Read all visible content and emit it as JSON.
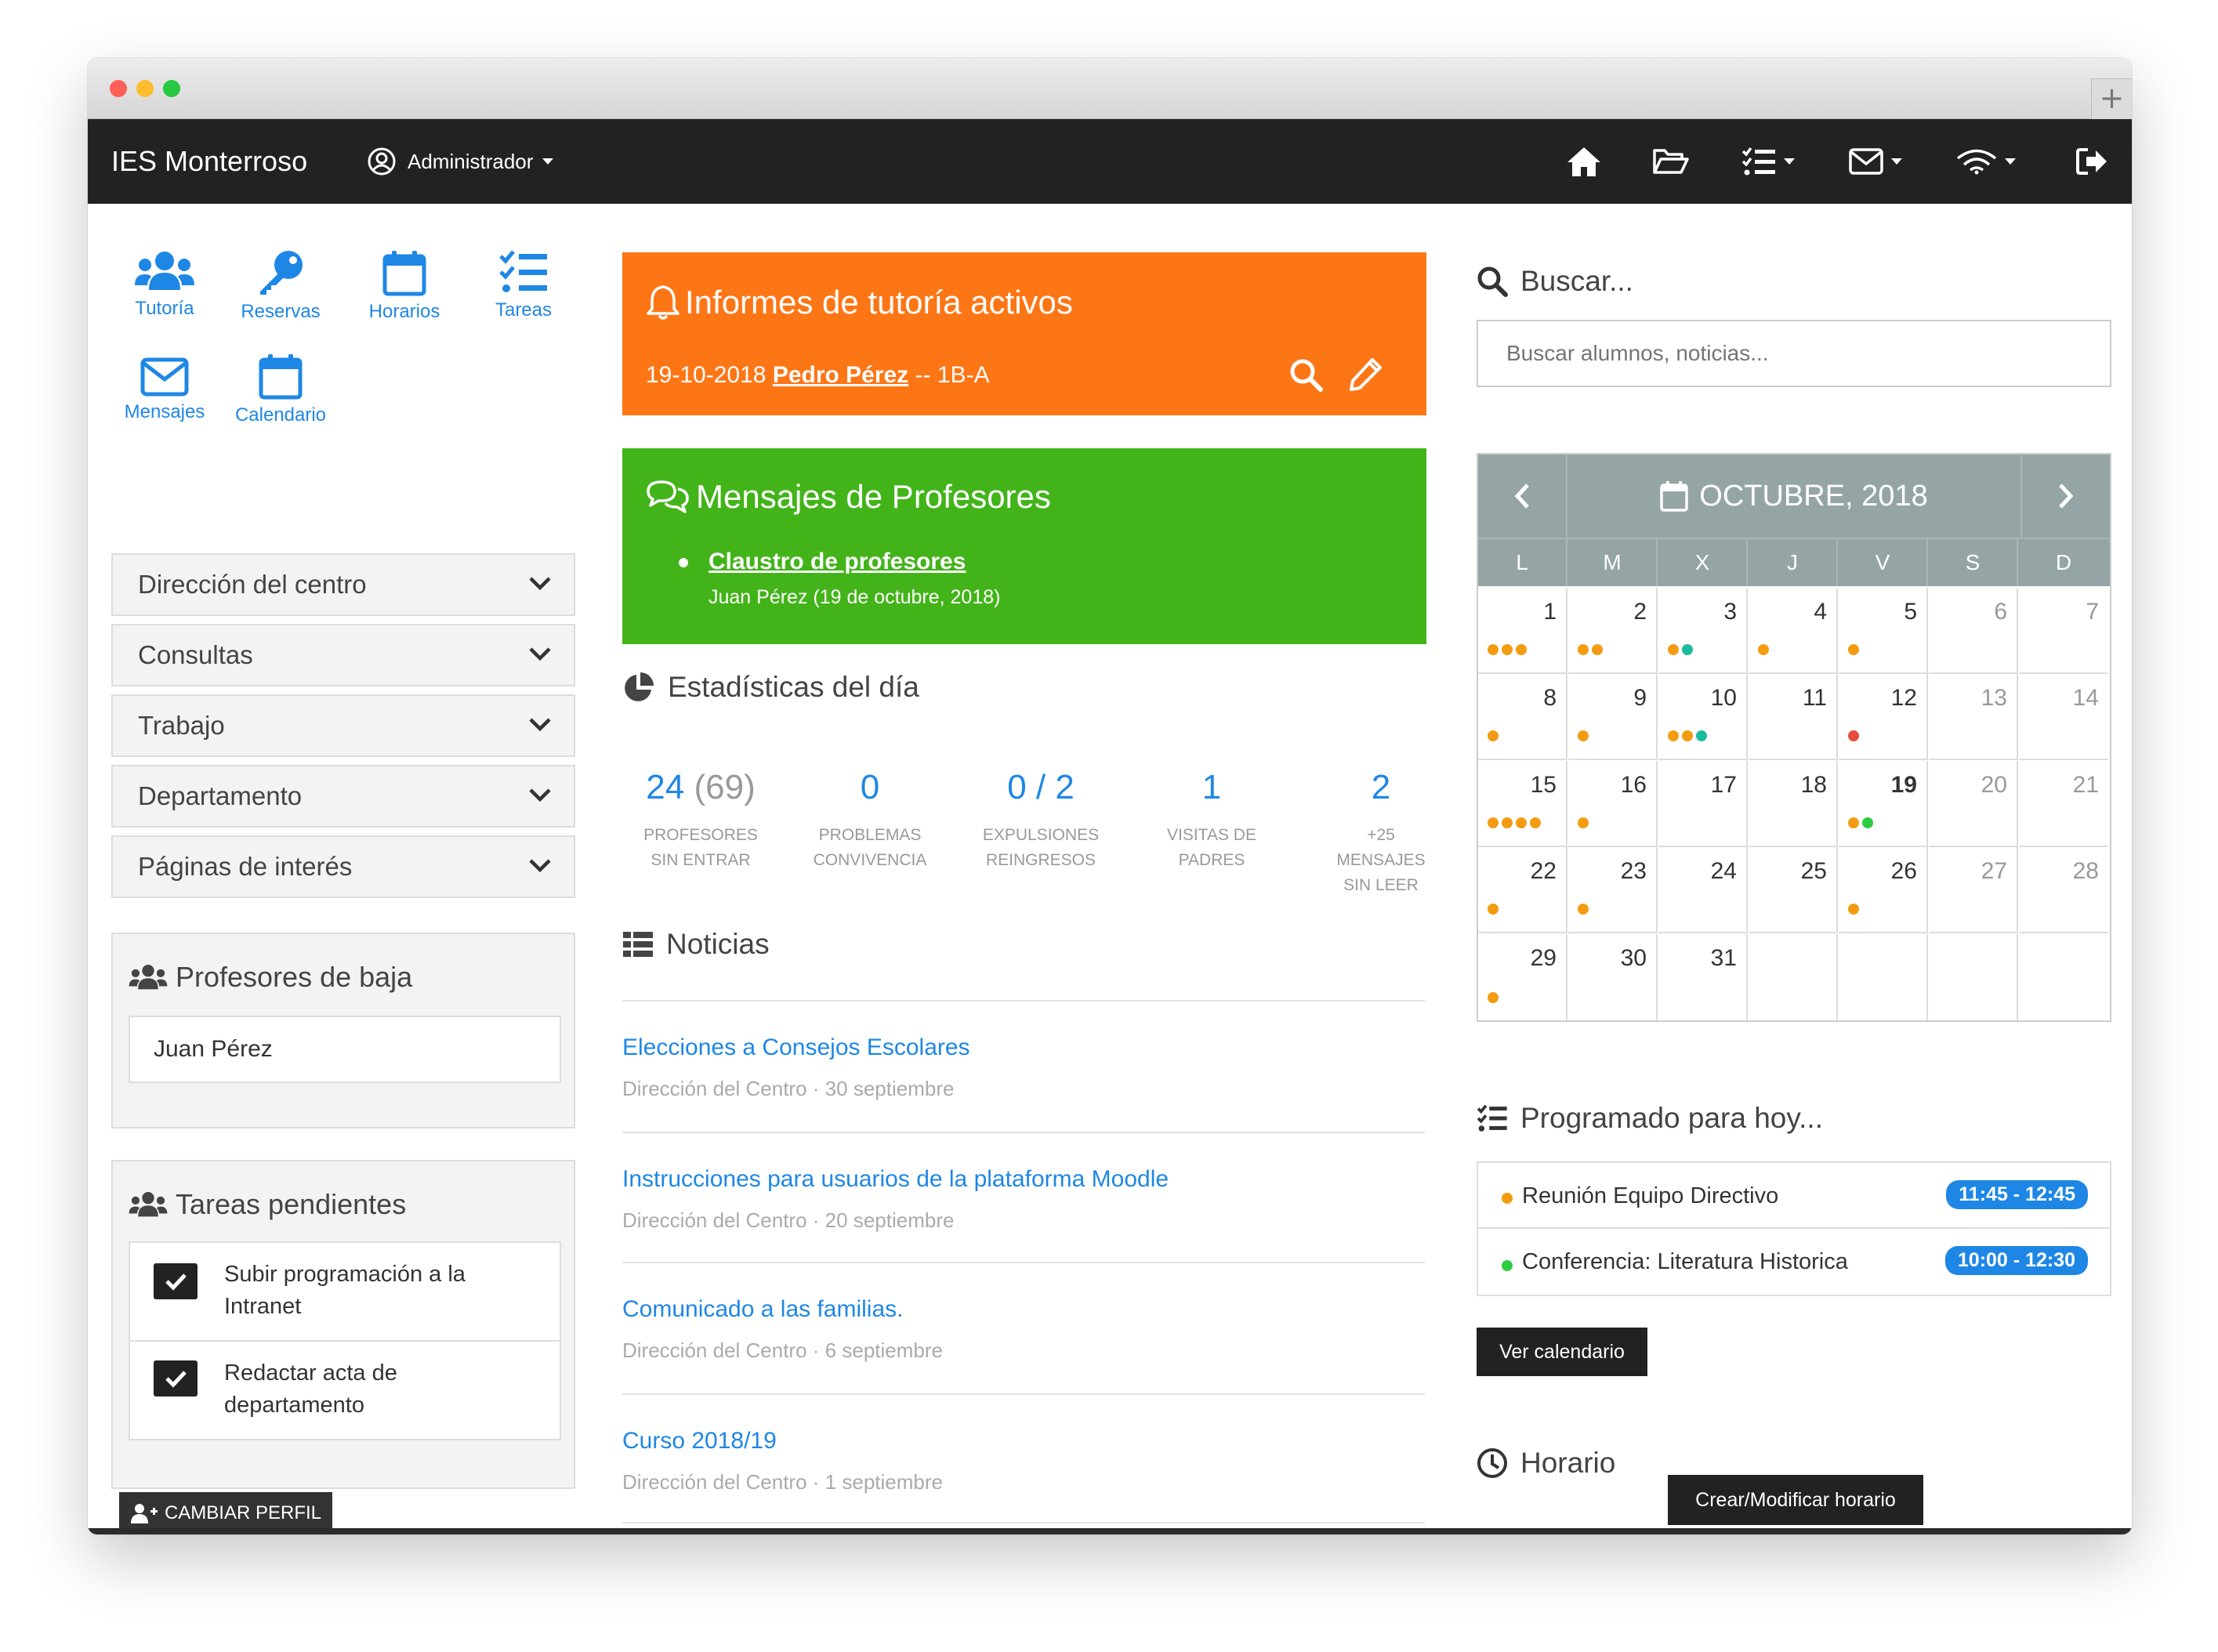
{
  "app": {
    "brand": "IES Monterroso",
    "user": "Administrador"
  },
  "quick": [
    {
      "label": "Tutoría",
      "icon": "users-icon"
    },
    {
      "label": "Reservas",
      "icon": "key-icon"
    },
    {
      "label": "Horarios",
      "icon": "calendar-icon"
    },
    {
      "label": "Tareas",
      "icon": "tasks-icon"
    },
    {
      "label": "Mensajes",
      "icon": "envelope-icon"
    },
    {
      "label": "Calendario",
      "icon": "calendar-icon"
    }
  ],
  "menu": [
    "Dirección del centro",
    "Consultas",
    "Trabajo",
    "Departamento",
    "Páginas de interés"
  ],
  "baja": {
    "title": "Profesores de baja",
    "item": "Juan Pérez"
  },
  "tareas": {
    "title": "Tareas pendientes",
    "items": [
      "Subir programación a la Intranet",
      "Redactar acta de departamento"
    ]
  },
  "cambiar": "CAMBIAR PERFIL",
  "informes": {
    "title": "Informes de tutoría activos",
    "date": "19-10-2018",
    "name": "Pedro Pérez",
    "group": "-- 1B-A"
  },
  "mensajes": {
    "title": "Mensajes de Profesores",
    "link": "Claustro de profesores",
    "meta": "Juan Pérez (19 de octubre, 2018)"
  },
  "stats": {
    "title": "Estadísticas del día",
    "items": [
      {
        "value": "24",
        "extra": "(69)",
        "l1": "PROFESORES",
        "l2": "SIN ENTRAR",
        "l3": ""
      },
      {
        "value": "0",
        "extra": "",
        "l1": "PROBLEMAS",
        "l2": "CONVIVENCIA",
        "l3": ""
      },
      {
        "value": "0 / 2",
        "extra": "",
        "l1": "EXPULSIONES",
        "l2": "REINGRESOS",
        "l3": ""
      },
      {
        "value": "1",
        "extra": "",
        "l1": "VISITAS DE",
        "l2": "PADRES",
        "l3": ""
      },
      {
        "value": "2",
        "extra": "",
        "l1": "+25",
        "l2": "MENSAJES",
        "l3": "SIN LEER"
      }
    ]
  },
  "noticias": {
    "title": "Noticias",
    "items": [
      {
        "title": "Elecciones a Consejos Escolares",
        "source": "Dirección del Centro",
        "date": "30 septiembre"
      },
      {
        "title": "Instrucciones para usuarios de la plataforma Moodle",
        "source": "Dirección del Centro",
        "date": "20 septiembre"
      },
      {
        "title": "Comunicado a las familias.",
        "source": "Dirección del Centro",
        "date": "6 septiembre"
      },
      {
        "title": "Curso 2018/19",
        "source": "Dirección del Centro",
        "date": "1 septiembre"
      }
    ]
  },
  "search": {
    "title": "Buscar...",
    "placeholder": "Buscar alumnos, noticias..."
  },
  "calendar": {
    "month": "OCTUBRE, 2018",
    "days": [
      "L",
      "M",
      "X",
      "J",
      "V",
      "S",
      "D"
    ],
    "today": 19,
    "colors": {
      "o": "#f39c12",
      "g": "#2ecc40",
      "t": "#1abc9c",
      "r": "#e74c3c"
    },
    "weeks": [
      [
        {
          "d": "1",
          "dots": "ooo"
        },
        {
          "d": "2",
          "dots": "oo"
        },
        {
          "d": "3",
          "dots": "ot"
        },
        {
          "d": "4",
          "dots": "o"
        },
        {
          "d": "5",
          "dots": "o"
        },
        {
          "d": "6",
          "dots": ""
        },
        {
          "d": "7",
          "dots": ""
        }
      ],
      [
        {
          "d": "8",
          "dots": "o"
        },
        {
          "d": "9",
          "dots": "o"
        },
        {
          "d": "10",
          "dots": "oot"
        },
        {
          "d": "11",
          "dots": ""
        },
        {
          "d": "12",
          "dots": "r"
        },
        {
          "d": "13",
          "dots": ""
        },
        {
          "d": "14",
          "dots": ""
        }
      ],
      [
        {
          "d": "15",
          "dots": "oooo"
        },
        {
          "d": "16",
          "dots": "o"
        },
        {
          "d": "17",
          "dots": ""
        },
        {
          "d": "18",
          "dots": ""
        },
        {
          "d": "19",
          "dots": "og"
        },
        {
          "d": "20",
          "dots": ""
        },
        {
          "d": "21",
          "dots": ""
        }
      ],
      [
        {
          "d": "22",
          "dots": "o"
        },
        {
          "d": "23",
          "dots": "o"
        },
        {
          "d": "24",
          "dots": ""
        },
        {
          "d": "25",
          "dots": ""
        },
        {
          "d": "26",
          "dots": "o"
        },
        {
          "d": "27",
          "dots": ""
        },
        {
          "d": "28",
          "dots": ""
        }
      ],
      [
        {
          "d": "29",
          "dots": "o"
        },
        {
          "d": "30",
          "dots": ""
        },
        {
          "d": "31",
          "dots": ""
        },
        {
          "d": "",
          "dots": ""
        },
        {
          "d": "",
          "dots": ""
        },
        {
          "d": "",
          "dots": ""
        },
        {
          "d": "",
          "dots": ""
        }
      ]
    ]
  },
  "programado": {
    "title": "Programado para hoy...",
    "items": [
      {
        "label": "Reunión Equipo Directivo",
        "time": "11:45 - 12:45",
        "color": "#f39c12"
      },
      {
        "label": "Conferencia: Literatura Historica",
        "time": "10:00 - 12:30",
        "color": "#2ecc40"
      }
    ],
    "button": "Ver calendario"
  },
  "horario": {
    "title": "Horario",
    "button": "Crear/Modificar horario"
  },
  "colors": {
    "orange": "#fd7616",
    "green": "#42b41a",
    "blue": "#1e87e5",
    "dark": "#222222"
  }
}
